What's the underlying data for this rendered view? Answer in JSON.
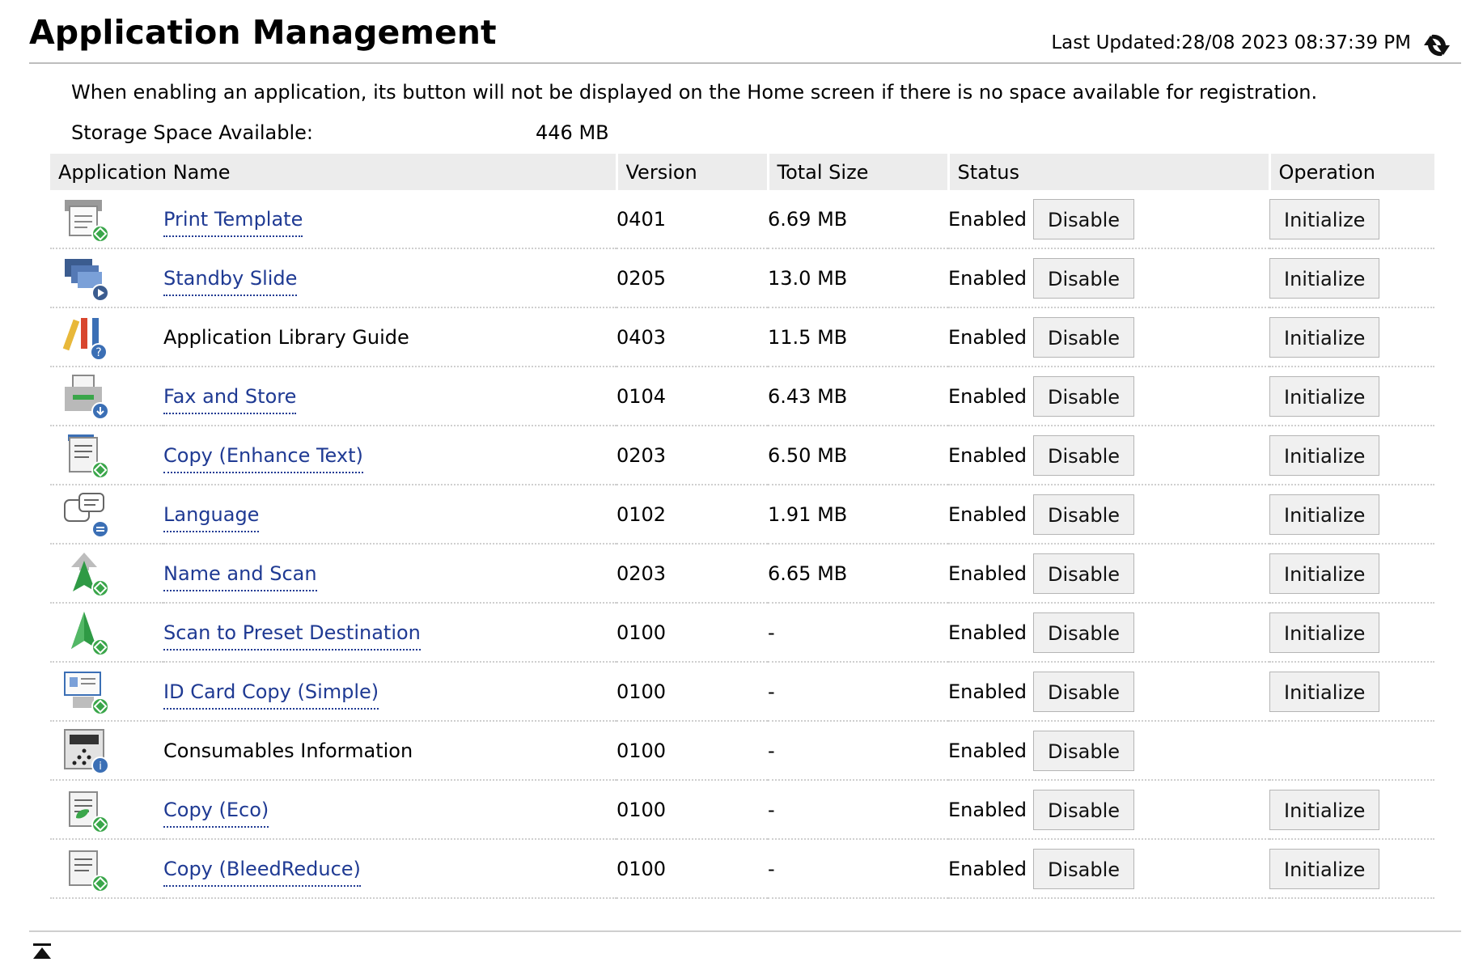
{
  "header": {
    "title": "Application Management",
    "last_updated_label": "Last Updated:",
    "last_updated_value": "28/08 2023 08:37:39 PM",
    "refresh_icon": "refresh-icon"
  },
  "notice": "When enabling an application, its button will not be displayed on the Home screen if there is no space available for registration.",
  "storage": {
    "label": "Storage Space Available:",
    "value": "446 MB"
  },
  "table": {
    "columns": [
      "Application Name",
      "Version",
      "Total Size",
      "Status",
      "Operation"
    ],
    "rows": [
      {
        "name": "Print Template",
        "link": true,
        "icon": "print-template-icon",
        "version": "0401",
        "size": "6.69 MB",
        "status": "Enabled",
        "status_button": "Disable",
        "operation": "Initialize"
      },
      {
        "name": "Standby Slide",
        "link": true,
        "icon": "standby-slide-icon",
        "version": "0205",
        "size": "13.0 MB",
        "status": "Enabled",
        "status_button": "Disable",
        "operation": "Initialize"
      },
      {
        "name": "Application Library Guide",
        "link": false,
        "icon": "library-guide-icon",
        "version": "0403",
        "size": "11.5 MB",
        "status": "Enabled",
        "status_button": "Disable",
        "operation": "Initialize"
      },
      {
        "name": "Fax and Store",
        "link": true,
        "icon": "fax-store-icon",
        "version": "0104",
        "size": "6.43 MB",
        "status": "Enabled",
        "status_button": "Disable",
        "operation": "Initialize"
      },
      {
        "name": "Copy (Enhance Text)",
        "link": true,
        "icon": "copy-enhance-icon",
        "version": "0203",
        "size": "6.50 MB",
        "status": "Enabled",
        "status_button": "Disable",
        "operation": "Initialize"
      },
      {
        "name": "Language",
        "link": true,
        "icon": "language-icon",
        "version": "0102",
        "size": "1.91 MB",
        "status": "Enabled",
        "status_button": "Disable",
        "operation": "Initialize"
      },
      {
        "name": "Name and Scan",
        "link": true,
        "icon": "name-scan-icon",
        "version": "0203",
        "size": "6.65 MB",
        "status": "Enabled",
        "status_button": "Disable",
        "operation": "Initialize"
      },
      {
        "name": "Scan to Preset Destination",
        "link": true,
        "icon": "scan-preset-icon",
        "version": "0100",
        "size": "-",
        "status": "Enabled",
        "status_button": "Disable",
        "operation": "Initialize"
      },
      {
        "name": "ID Card Copy (Simple)",
        "link": true,
        "icon": "id-card-copy-icon",
        "version": "0100",
        "size": "-",
        "status": "Enabled",
        "status_button": "Disable",
        "operation": "Initialize"
      },
      {
        "name": "Consumables Information",
        "link": false,
        "icon": "consumables-info-icon",
        "version": "0100",
        "size": "-",
        "status": "Enabled",
        "status_button": "Disable",
        "operation": ""
      },
      {
        "name": "Copy (Eco)",
        "link": true,
        "icon": "copy-eco-icon",
        "version": "0100",
        "size": "-",
        "status": "Enabled",
        "status_button": "Disable",
        "operation": "Initialize"
      },
      {
        "name": "Copy (BleedReduce)",
        "link": true,
        "icon": "copy-bleed-icon",
        "version": "0100",
        "size": "-",
        "status": "Enabled",
        "status_button": "Disable",
        "operation": "Initialize"
      }
    ]
  },
  "footer": {
    "top_icon": "scroll-to-top-icon"
  },
  "colors": {
    "link": "#1f3a93",
    "header_bg": "#ececec",
    "button_bg": "#f0f0f0"
  }
}
